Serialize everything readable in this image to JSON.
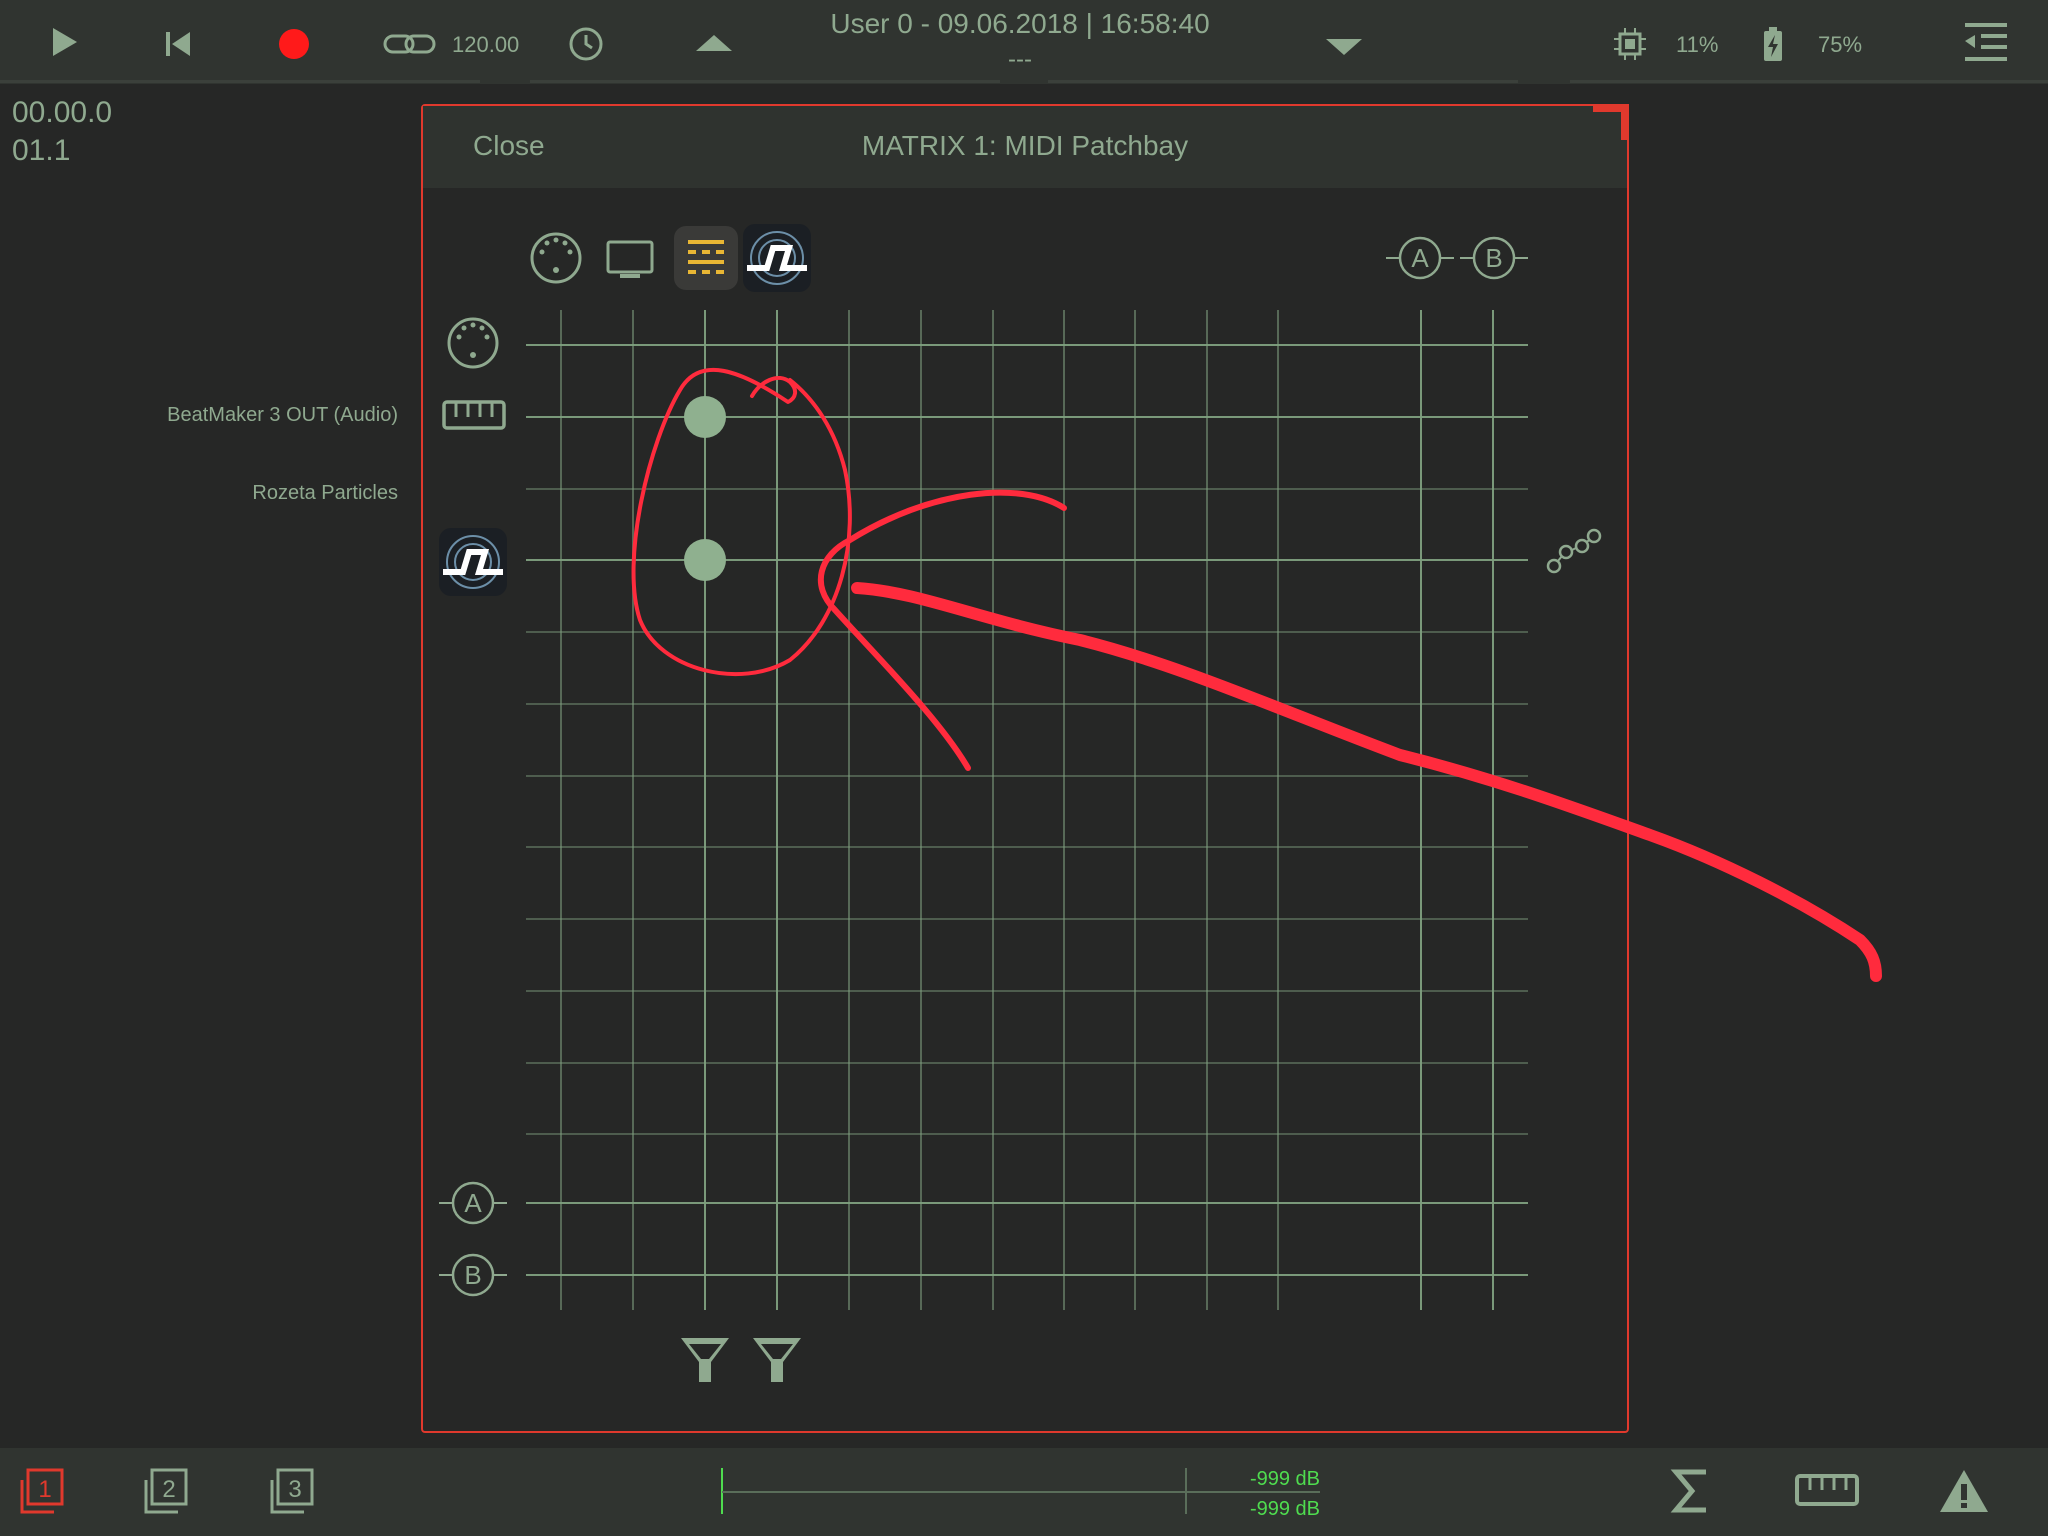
{
  "topbar": {
    "tempo": "120.00",
    "title": "User 0 - 09.06.2018 | 16:58:40",
    "subtitle": "---",
    "cpu": "11%",
    "battery": "75%",
    "icons": [
      "play-icon",
      "skip-back-icon",
      "record-icon",
      "link-icon",
      "clock-icon",
      "up-triangle-icon",
      "down-triangle-icon",
      "cpu-icon",
      "battery-icon",
      "list-menu-icon"
    ],
    "accent_record": "#ff1a1a"
  },
  "counters": {
    "position": "00.00.0",
    "bar": "01.1"
  },
  "modal": {
    "close_label": "Close",
    "title": "MATRIX 1:  MIDI Patchbay",
    "border_color": "#e0392d",
    "column_headers": [
      "midi-port-icon",
      "screen-icon",
      "beatmaker-app-icon",
      "rozeta-app-icon"
    ],
    "bus_labels": {
      "a": "A",
      "b": "B"
    },
    "rows": [
      {
        "label": "",
        "icon": "midi-port-icon"
      },
      {
        "label": "BeatMaker 3 OUT (Audio)",
        "icon": "keyboard-icon"
      },
      {
        "label": "Rozeta Particles",
        "icon": ""
      },
      {
        "label": "",
        "icon": "rozeta-app-icon"
      }
    ],
    "connections": [
      {
        "row": 1,
        "col": 2
      },
      {
        "row": 3,
        "col": 2
      }
    ],
    "grid_color": "#7fa07f"
  },
  "bottombar": {
    "layer_labels": [
      "1",
      "2",
      "3"
    ],
    "db_top": "-999 dB",
    "db_bottom": "-999 dB",
    "icons": [
      "layer-1-icon",
      "layer-2-icon",
      "layer-3-icon",
      "sigma-icon",
      "keyboard-icon",
      "warning-icon"
    ],
    "active_color": "#e0392d"
  }
}
